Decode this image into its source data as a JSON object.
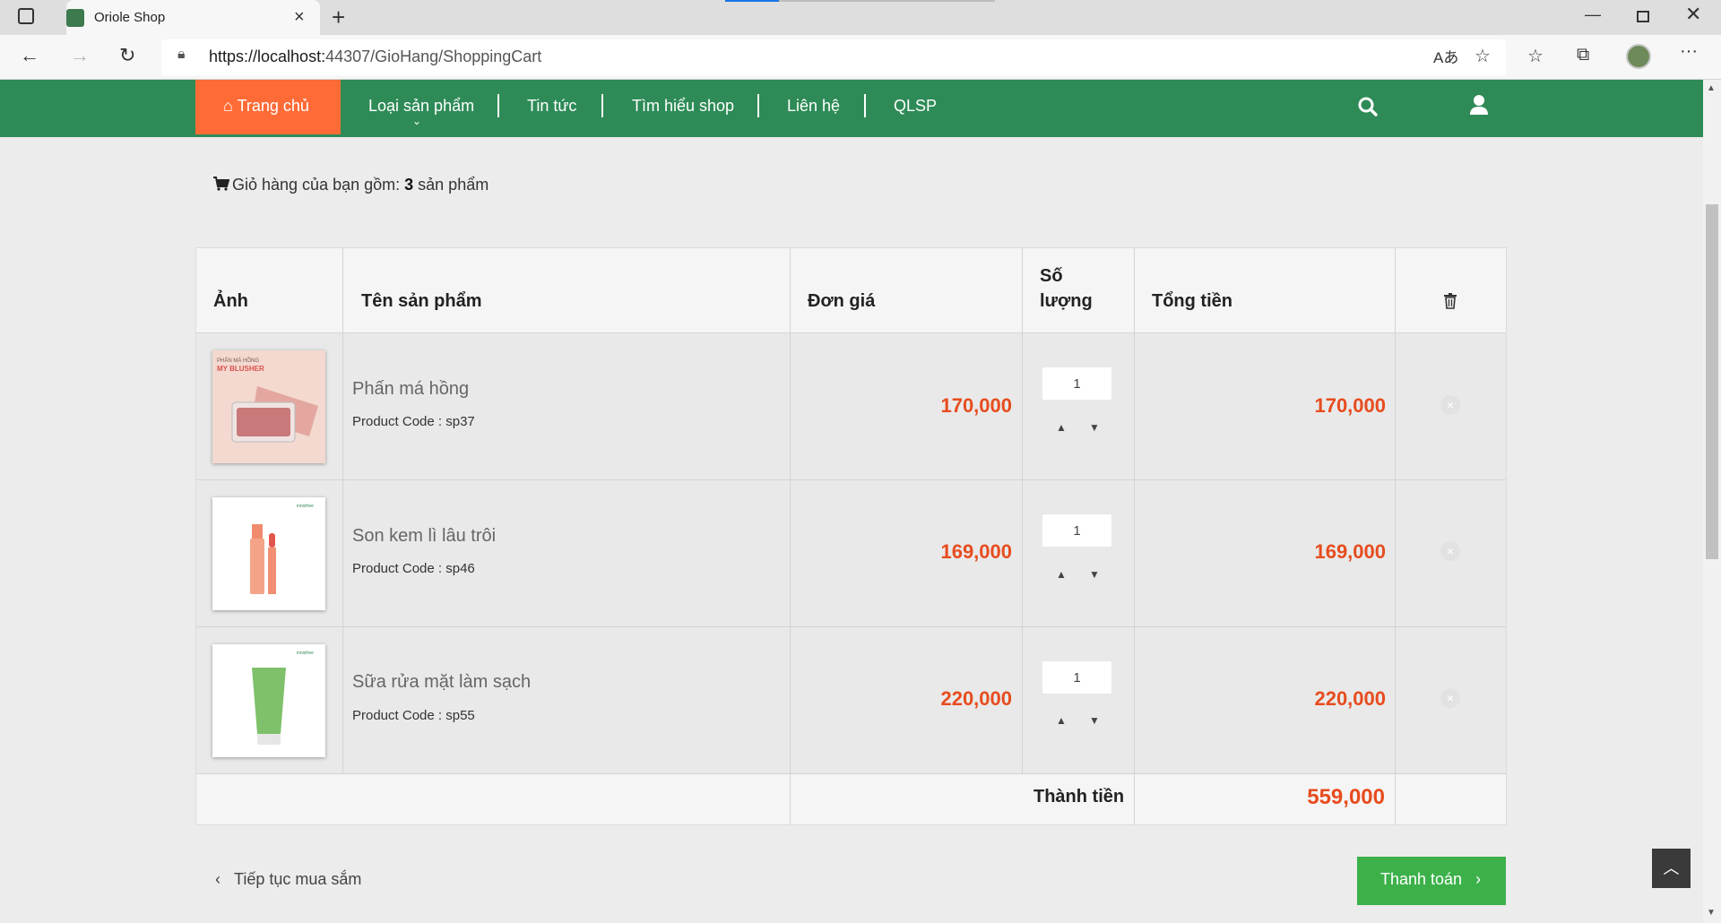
{
  "browser": {
    "tab_title": "Oriole Shop",
    "url_host": "https://localhost:",
    "url_rest": "44307/GioHang/ShoppingCart"
  },
  "nav": {
    "home": "Trang chủ",
    "items": [
      "Loại sản phẩm",
      "Tin tức",
      "Tìm hiểu shop",
      "Liên hệ",
      "QLSP"
    ]
  },
  "cart": {
    "heading_prefix": "Giỏ hàng của bạn gồm: ",
    "count": "3",
    "heading_suffix": " sản phẩm"
  },
  "table": {
    "headers": {
      "image": "Ảnh",
      "name": "Tên sản phẩm",
      "unit_price": "Đơn giá",
      "qty_line1": "Số",
      "qty_line2": "lượng",
      "total": "Tổng tiền"
    },
    "rows": [
      {
        "name": "Phấn má hồng",
        "code": "Product Code : sp37",
        "price": "170,000",
        "qty": "1",
        "total": "170,000"
      },
      {
        "name": "Son kem lì lâu trôi",
        "code": "Product Code : sp46",
        "price": "169,000",
        "qty": "1",
        "total": "169,000"
      },
      {
        "name": "Sữa rửa mặt làm sạch",
        "code": "Product Code : sp55",
        "price": "220,000",
        "qty": "1",
        "total": "220,000"
      }
    ],
    "grand_total_label": "Thành tiền",
    "grand_total": "559,000"
  },
  "actions": {
    "continue": "Tiếp tục mua sắm",
    "checkout": "Thanh toán"
  },
  "colors": {
    "navbar": "#2e8b57",
    "home_tab": "#ff6b36",
    "price": "#e74c1e",
    "checkout": "#3cb14a"
  },
  "icons": [
    "home-icon",
    "search-icon",
    "user-icon",
    "cart-icon",
    "trash-icon",
    "remove-icon",
    "chevron-left-icon",
    "chevron-right-icon",
    "arrow-up-icon"
  ]
}
